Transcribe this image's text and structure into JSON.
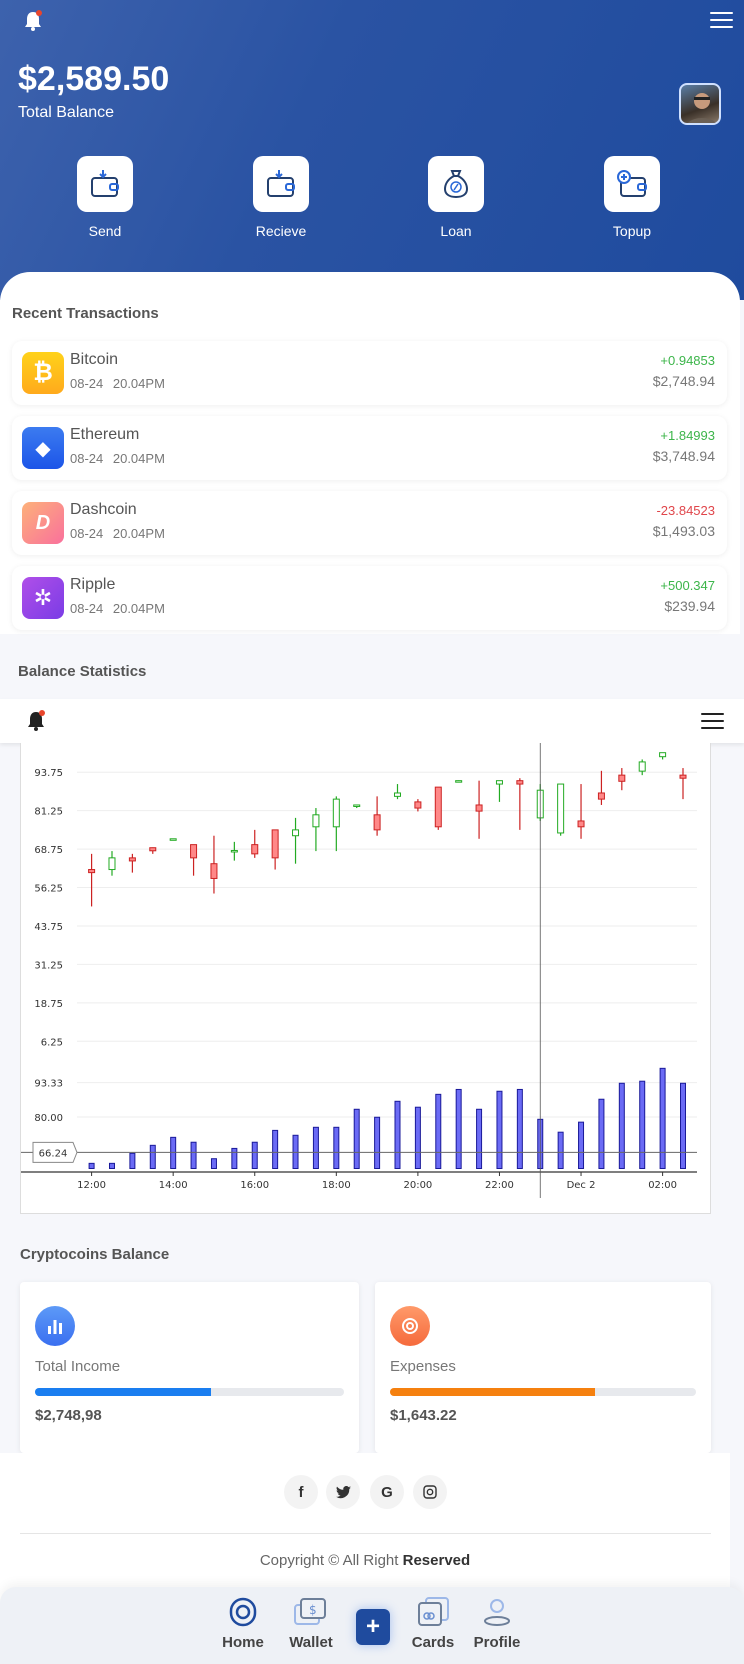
{
  "header": {
    "balance": "$2,589.50",
    "balance_label": "Total Balance",
    "notification_badge": "1",
    "actions": [
      {
        "label": "Send",
        "icon": "wallet-send-icon"
      },
      {
        "label": "Recieve",
        "icon": "wallet-receive-icon"
      },
      {
        "label": "Loan",
        "icon": "money-bag-percent-icon"
      },
      {
        "label": "Topup",
        "icon": "wallet-plus-icon"
      }
    ]
  },
  "transactions": {
    "title": "Recent Transactions",
    "items": [
      {
        "name": "Bitcoin",
        "date": "08-24 20.04PM",
        "amount": "+0.94853",
        "value": "$2,748.94",
        "color": "#ffb61a",
        "symbol": "₿",
        "positive": true
      },
      {
        "name": "Ethereum",
        "date": "08-24 20.04PM",
        "amount": "+1.84993",
        "value": "$3,748.94",
        "color": "#2f6cf0",
        "symbol": "◆",
        "positive": true
      },
      {
        "name": "Dashcoin",
        "date": "08-24 20.04PM",
        "amount": "-23.84523",
        "value": "$1,493.03",
        "color": "#fb8b8f",
        "symbol": "D",
        "positive": false
      },
      {
        "name": "Ripple",
        "date": "08-24 20.04PM",
        "amount": "+500.347",
        "value": "$239.94",
        "color": "#9247e8",
        "symbol": "✲",
        "positive": true
      }
    ]
  },
  "statistics": {
    "title": "Balance Statistics",
    "notification_badge": "1"
  },
  "chart_data": {
    "type": "candlestick",
    "price_axis": {
      "ticks": [
        "6.25",
        "18.75",
        "31.25",
        "43.75",
        "56.25",
        "68.75",
        "81.25",
        "93.75"
      ],
      "range": [
        0,
        102.5
      ]
    },
    "volume_axis": {
      "ticks": [
        "80.00",
        "93.33"
      ],
      "range": [
        60,
        101.5
      ]
    },
    "x_ticks": [
      "12:00",
      "14:00",
      "16:00",
      "18:00",
      "20:00",
      "22:00",
      "Dec 2",
      "02:00"
    ],
    "x": [
      "12:00",
      "12:30",
      "13:00",
      "13:30",
      "14:00",
      "14:30",
      "15:00",
      "15:30",
      "16:00",
      "16:30",
      "17:00",
      "17:30",
      "18:00",
      "18:30",
      "19:00",
      "19:30",
      "20:00",
      "20:30",
      "21:00",
      "21:30",
      "22:00",
      "22:30",
      "23:00",
      "23:30",
      "00:00",
      "00:30",
      "01:00",
      "01:30",
      "02:00",
      "02:30"
    ],
    "ohlc": [
      [
        62.1,
        67.2,
        50.1,
        61.1
      ],
      [
        62.1,
        68.1,
        60.1,
        65.9
      ],
      [
        65.9,
        67.2,
        61.1,
        64.9
      ],
      [
        69.2,
        69.3,
        67.2,
        68.2
      ],
      [
        72.0,
        72.2,
        71.9,
        72.1
      ],
      [
        70.2,
        70.2,
        60.1,
        65.9
      ],
      [
        64.0,
        73.1,
        54.3,
        59.2
      ],
      [
        68.1,
        71.1,
        65.0,
        68.3
      ],
      [
        70.2,
        75.0,
        65.9,
        67.2
      ],
      [
        75.0,
        75.0,
        62.1,
        65.9
      ],
      [
        73.1,
        78.9,
        64.0,
        75.0
      ],
      [
        76.0,
        82.1,
        68.1,
        79.9
      ],
      [
        76.0,
        85.9,
        68.1,
        85.0
      ],
      [
        82.9,
        83.2,
        82.1,
        83.1
      ],
      [
        79.9,
        85.9,
        73.1,
        75.0
      ],
      [
        85.9,
        89.9,
        85.0,
        87.0
      ],
      [
        84.1,
        85.0,
        81.0,
        82.1
      ],
      [
        88.9,
        88.9,
        75.0,
        76.0
      ],
      [
        90.9,
        91.1,
        90.9,
        91.0
      ],
      [
        83.1,
        91.0,
        72.1,
        81.1
      ],
      [
        89.9,
        91.0,
        84.1,
        91.0
      ],
      [
        91.0,
        91.8,
        75.0,
        89.9
      ],
      [
        78.9,
        89.9,
        77.9,
        87.9
      ],
      [
        74.0,
        89.9,
        73.1,
        89.9
      ],
      [
        77.9,
        89.9,
        72.1,
        76.0
      ],
      [
        87.0,
        94.2,
        83.1,
        85.0
      ],
      [
        92.8,
        95.1,
        87.9,
        90.8
      ],
      [
        94.1,
        97.9,
        92.8,
        97.1
      ],
      [
        98.8,
        100.1,
        97.9,
        100.1
      ],
      [
        92.8,
        95.1,
        85.0,
        91.8
      ]
    ],
    "volume": [
      62.0,
      62.0,
      65.9,
      69.0,
      72.1,
      70.2,
      63.8,
      67.8,
      70.2,
      74.8,
      72.9,
      76.0,
      76.0,
      83.0,
      79.9,
      86.1,
      83.8,
      88.8,
      90.7,
      83.0,
      90.0,
      90.7,
      79.1,
      74.1,
      78.0,
      86.9,
      93.1,
      93.9,
      98.9,
      93.1
    ],
    "volume_marker": "66.24",
    "crosshair_x": "23:00",
    "up_color": "#22aa22",
    "down_color": "#cc2222",
    "volume_color": "#6b6bf5",
    "grid": true
  },
  "balance": {
    "title": "Cryptocoins Balance",
    "cards": [
      {
        "label": "Total Income",
        "value": "$2,748,98",
        "progress": 57,
        "color": "#1a7ef0",
        "icon": "bar-chart-icon"
      },
      {
        "label": "Expenses",
        "value": "$1,643.22",
        "progress": 67,
        "color": "#f5800f",
        "icon": "target-icon"
      }
    ]
  },
  "footer": {
    "social": [
      "f",
      "t",
      "G",
      "ig"
    ],
    "copyright": "Copyright © All Right",
    "copyright_bold": "Reserved"
  },
  "bottom_nav": {
    "items": [
      {
        "label": "Home"
      },
      {
        "label": "Wallet"
      },
      {
        "label": "+"
      },
      {
        "label": "Cards"
      },
      {
        "label": "Profile"
      }
    ]
  }
}
